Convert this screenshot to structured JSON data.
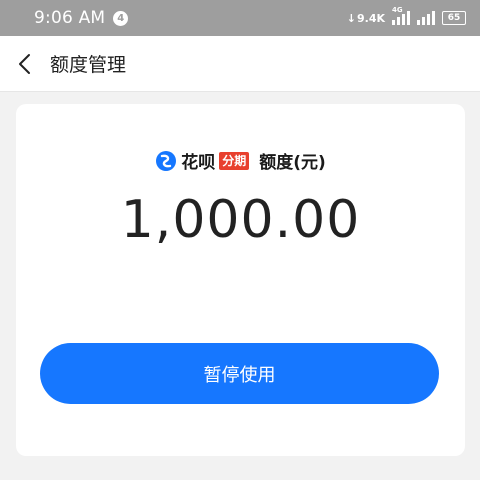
{
  "status_bar": {
    "time": "9:06 AM",
    "notification_count": "4",
    "net_speed": "9.4K",
    "network_type": "4G",
    "battery": "65"
  },
  "nav": {
    "title": "额度管理",
    "back_icon": "chevron-left-icon"
  },
  "card": {
    "brand_logo_icon": "huabei-logo-icon",
    "brand_name": "花呗",
    "brand_tag": "分期",
    "label": "额度(元)",
    "amount": "1,000.00",
    "pause_button_label": "暂停使用"
  },
  "colors": {
    "primary": "#1677ff",
    "tag_red": "#e8402e",
    "status_bar": "#9e9e9e"
  }
}
